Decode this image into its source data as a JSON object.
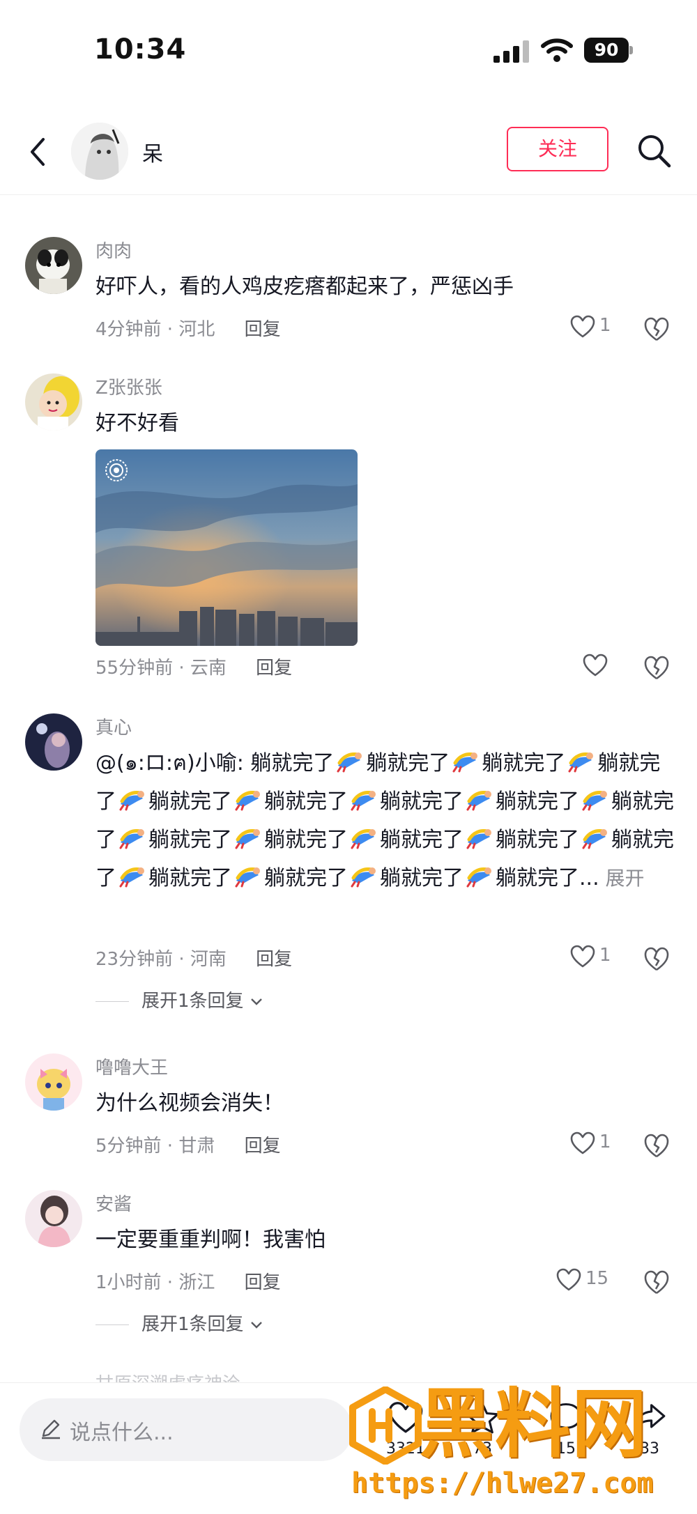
{
  "status_bar": {
    "time": "10:34",
    "battery": "90"
  },
  "header": {
    "name": "呆",
    "follow_label": "关注"
  },
  "comments": [
    {
      "user": "肉肉",
      "text": "好吓人，看的人鸡皮疙瘩都起来了，严惩凶手",
      "time": "4分钟前",
      "location": "河北",
      "reply_label": "回复",
      "likes": "1"
    },
    {
      "user": "Z张张张",
      "text": "好不好看",
      "time": "55分钟前",
      "location": "云南",
      "reply_label": "回复",
      "likes": ""
    },
    {
      "user": "真心",
      "mention": "@(๑:ロ:ฅ)小喻: ",
      "segments": [
        "躺就完了",
        "躺就完了",
        "躺就完了",
        "躺就完了",
        "躺就完了",
        "躺就完了",
        "躺就完了",
        "躺就完了",
        "躺就完了",
        "躺就完了",
        "躺就完了",
        "躺就完了",
        "躺就完了",
        "躺就完了",
        "躺就完了",
        "躺就完了",
        "躺就完了",
        "躺就完了"
      ],
      "ellipsis": "...",
      "more_label": "展开",
      "time": "23分钟前",
      "location": "河南",
      "reply_label": "回复",
      "likes": "1",
      "expand_label": "展开1条回复"
    },
    {
      "user": "噜噜大王",
      "text": "为什么视频会消失！",
      "time": "5分钟前",
      "location": "甘肃",
      "reply_label": "回复",
      "likes": "1"
    },
    {
      "user": "安酱",
      "text": "一定要重重判啊！我害怕",
      "time": "1小时前",
      "location": "浙江",
      "reply_label": "回复",
      "likes": "15",
      "expand_label": "展开1条回复"
    }
  ],
  "meta_separator": " · ",
  "peek_user": "甘原深溯虐痉神浍",
  "bottom_bar": {
    "input_placeholder": "说点什么...",
    "actions": [
      {
        "icon": "heart-icon",
        "count": "3321"
      },
      {
        "icon": "star-icon",
        "count": "73"
      },
      {
        "icon": "comment-icon",
        "count": "15"
      },
      {
        "icon": "share-icon",
        "count": "33"
      }
    ]
  },
  "watermark": {
    "title": "黑料网",
    "url": "https://hlwe27.com"
  },
  "colors": {
    "accent": "#fe2c55",
    "text": "#161823",
    "muted": "#8a8b91",
    "watermark": "#f59c12"
  }
}
